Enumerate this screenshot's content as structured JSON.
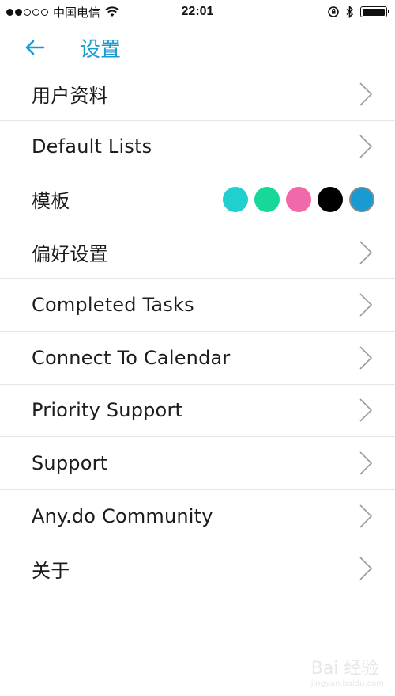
{
  "status_bar": {
    "carrier": "中国电信",
    "time": "22:01"
  },
  "header": {
    "title": "设置"
  },
  "colors": {
    "accent": "#1b9ad0"
  },
  "rows": [
    {
      "label": "用户资料"
    },
    {
      "label": "Default Lists"
    },
    {
      "label": "模板",
      "swatches": [
        "#1fd0cf",
        "#17d89a",
        "#f06aa9",
        "#000000",
        "#1a9ad3"
      ],
      "selected": 4
    },
    {
      "label": "偏好设置"
    },
    {
      "label": "Completed Tasks"
    },
    {
      "label": "Connect To Calendar"
    },
    {
      "label": "Priority Support"
    },
    {
      "label": "Support"
    },
    {
      "label": "Any.do Community"
    },
    {
      "label": "关于"
    }
  ],
  "watermark": {
    "text": "Bai 经验",
    "sub": "jingyan.baidu.com"
  }
}
